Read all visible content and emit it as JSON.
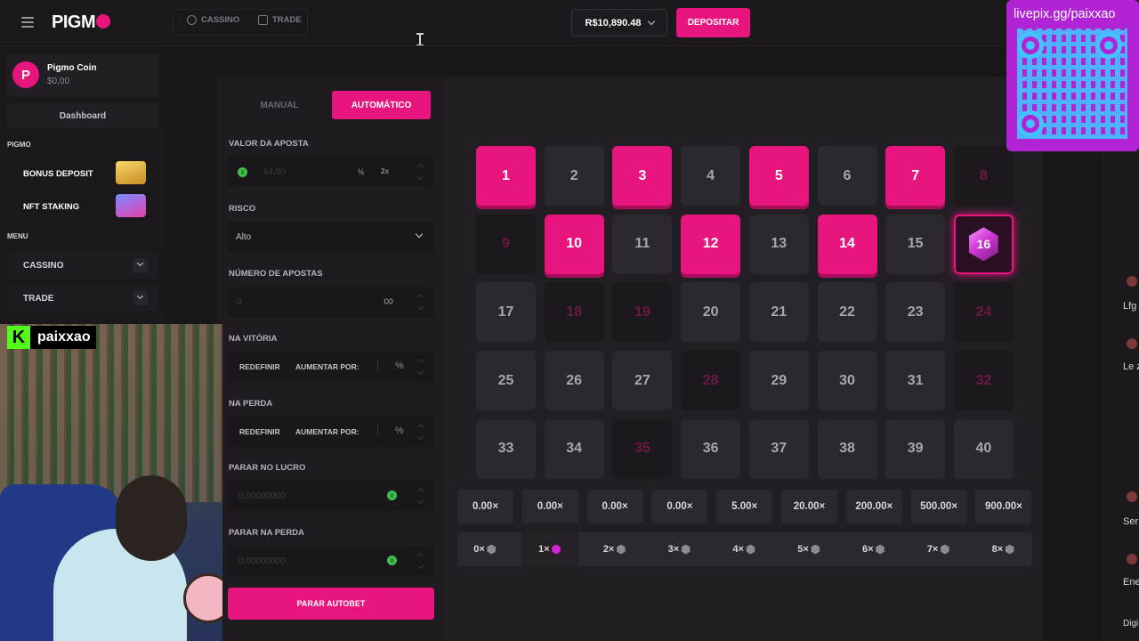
{
  "header": {
    "logo_text": "PIGM",
    "nav": [
      {
        "label": "CASSINO",
        "icon": "casino-icon"
      },
      {
        "label": "TRADE",
        "icon": "trade-icon"
      }
    ],
    "balance": "R$10,890.48",
    "deposit_label": "DEPOSITAR"
  },
  "sidebar": {
    "coin": {
      "avatar_letter": "P",
      "name": "Pigmo Coin",
      "balance": "$0,00"
    },
    "dashboard_label": "Dashboard",
    "section_pigmo": "PIGMO",
    "promos": [
      {
        "label": "BONUS DEPOSIT",
        "icon": "treasure-icon"
      },
      {
        "label": "NFT STAKING",
        "icon": "chest-icon"
      }
    ],
    "section_menu": "MENU",
    "menu": [
      {
        "label": "CASSINO"
      },
      {
        "label": "TRADE"
      }
    ]
  },
  "stream": {
    "kick_letter": "K",
    "channel": "paixxao"
  },
  "controls": {
    "tab_manual": "MANUAL",
    "tab_auto": "AUTOMÁTICO",
    "bet_label": "VALOR DA APOSTA",
    "bet_value": "64,00",
    "half_label": "½",
    "double_label": "2x",
    "risk_label": "RISCO",
    "risk_value": "Alto",
    "num_bets_label": "NÚMERO DE APOSTAS",
    "num_bets_value": "0",
    "infinity_label": "∞",
    "on_win_label": "NA VITÓRIA",
    "on_loss_label": "NA PERDA",
    "reset_label": "REDEFINIR",
    "increase_label": "AUMENTAR POR:",
    "percent_label": "%",
    "stop_profit_label": "PARAR NO LUCRO",
    "stop_profit_value": "0,00000000",
    "stop_loss_label": "PARAR NA PERDA",
    "stop_loss_value": "0,00000000",
    "stop_autobet_label": "PARAR AUTOBET"
  },
  "board": {
    "tiles": [
      "1",
      "2",
      "3",
      "4",
      "5",
      "6",
      "7",
      "8",
      "9",
      "10",
      "11",
      "12",
      "13",
      "14",
      "15",
      "16",
      "17",
      "18",
      "19",
      "20",
      "21",
      "22",
      "23",
      "24",
      "25",
      "26",
      "27",
      "28",
      "29",
      "30",
      "31",
      "32",
      "33",
      "34",
      "35",
      "36",
      "37",
      "38",
      "39",
      "40"
    ],
    "selected": [
      1,
      3,
      5,
      7,
      10,
      12,
      14
    ],
    "drawn": [
      8,
      9,
      18,
      19,
      24,
      28,
      32,
      35
    ],
    "hit": [
      16
    ],
    "multipliers": [
      "0.00×",
      "0.00×",
      "0.00×",
      "0.00×",
      "5.00×",
      "20.00×",
      "200.00×",
      "500.00×",
      "900.00×"
    ],
    "hit_counts": [
      "0×",
      "1×",
      "2×",
      "3×",
      "4×",
      "5×",
      "6×",
      "7×",
      "8×"
    ],
    "current_hits": 1
  },
  "overlay": {
    "livepix_text": "livepix.gg/paixxao"
  },
  "right_rail": {
    "items": [
      "Lfg",
      "Le z",
      "Ser",
      "Ene",
      "Digi"
    ]
  },
  "colors": {
    "accent": "#e8157f",
    "background": "#1a171b",
    "panel": "#221e23",
    "tile": "#2d282f",
    "gem": "#d03ad6",
    "qr_bg": "#b323d6",
    "kick_green": "#53fc18"
  }
}
